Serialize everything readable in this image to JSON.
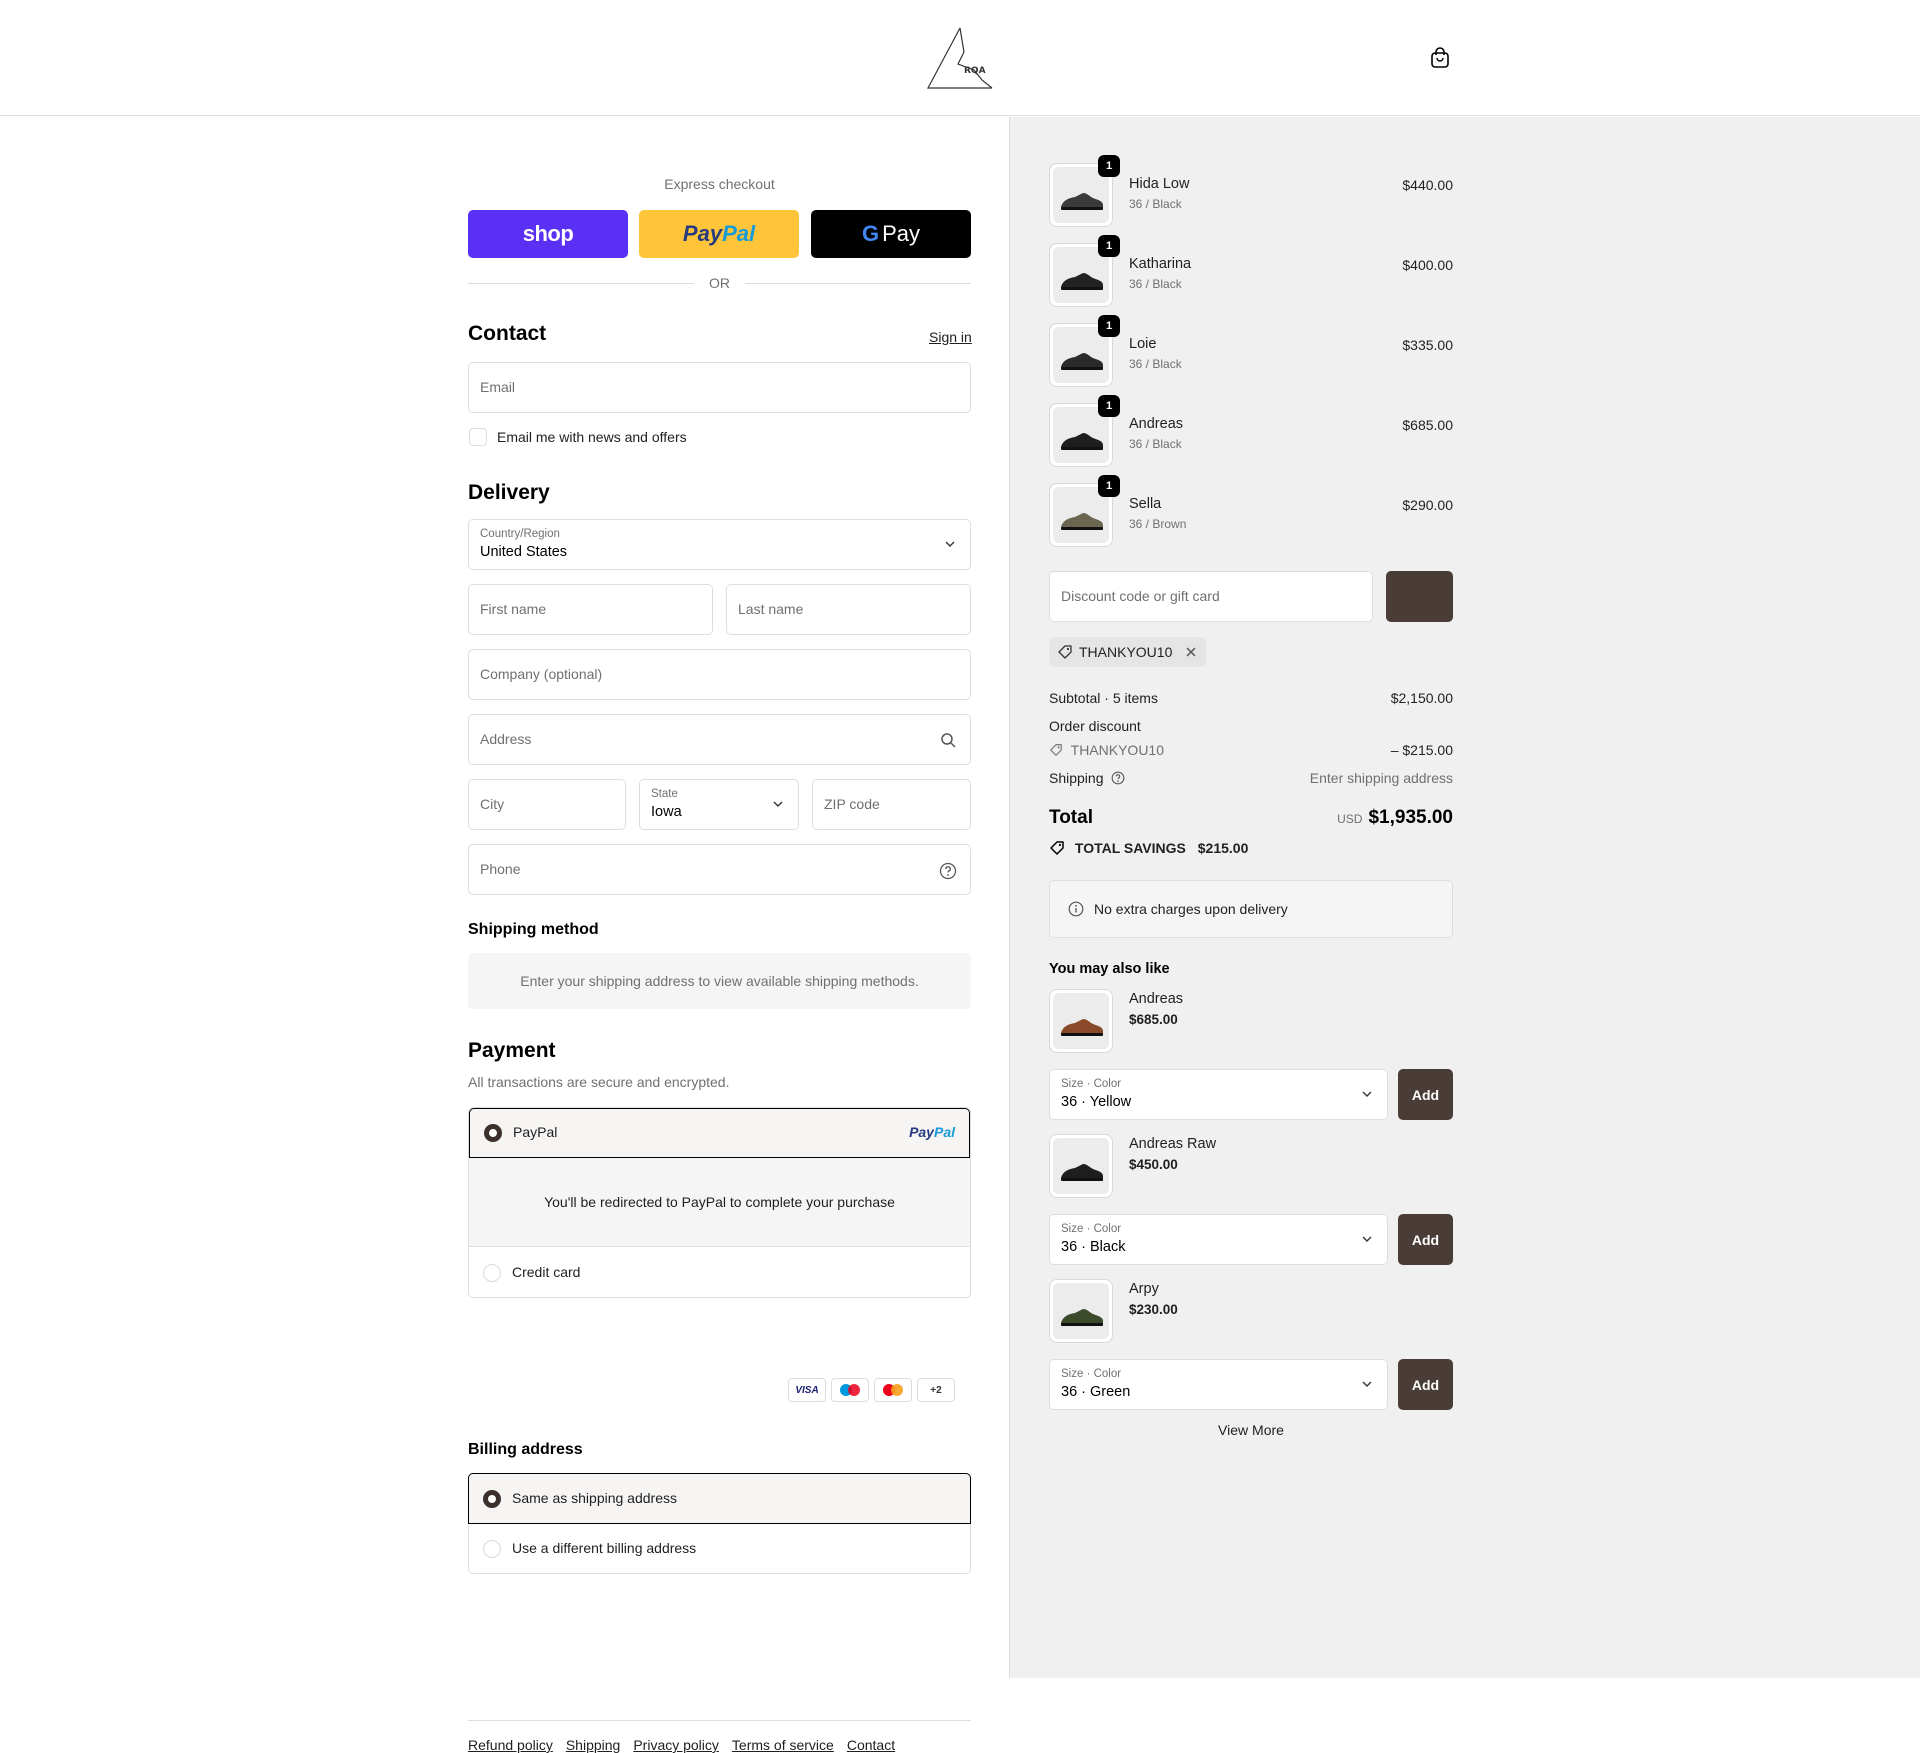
{
  "header": {
    "logo_text": "RQA"
  },
  "express": {
    "title": "Express checkout",
    "shop_label": "shop",
    "paypal_label_1": "Pay",
    "paypal_label_2": "Pal",
    "gpay_g": "G",
    "gpay_label": "Pay",
    "or_label": "OR"
  },
  "contact": {
    "heading": "Contact",
    "signin_label": "Sign in",
    "email_placeholder": "Email",
    "news_label": "Email me with news and offers"
  },
  "delivery": {
    "heading": "Delivery",
    "country_label": "Country/Region",
    "country_value": "United States",
    "first_name_placeholder": "First name",
    "last_name_placeholder": "Last name",
    "company_placeholder": "Company (optional)",
    "address_placeholder": "Address",
    "city_placeholder": "City",
    "state_label": "State",
    "state_value": "Iowa",
    "zip_placeholder": "ZIP code",
    "phone_placeholder": "Phone"
  },
  "shipping_method": {
    "heading": "Shipping method",
    "message": "Enter your shipping address to view available shipping methods."
  },
  "payment": {
    "heading": "Payment",
    "subtitle": "All transactions are secure and encrypted.",
    "paypal_option": "PayPal",
    "paypal_logo_1": "Pay",
    "paypal_logo_2": "Pal",
    "paypal_info": "You'll be redirected to PayPal to complete your purchase",
    "credit_option": "Credit card",
    "card_visa": "VISA",
    "card_more": "+2"
  },
  "billing": {
    "heading": "Billing address",
    "same_option": "Same as shipping address",
    "different_option": "Use a different billing address"
  },
  "footer": {
    "links": [
      "Refund policy",
      "Shipping",
      "Privacy policy",
      "Terms of service",
      "Contact"
    ]
  },
  "cart": {
    "items": [
      {
        "name": "Hida Low",
        "variant": "36 / Black",
        "price": "$440.00",
        "qty": "1",
        "color": "#3a3a3a"
      },
      {
        "name": "Katharina",
        "variant": "36 / Black",
        "price": "$400.00",
        "qty": "1",
        "color": "#222222"
      },
      {
        "name": "Loie",
        "variant": "36 / Black",
        "price": "$335.00",
        "qty": "1",
        "color": "#2a2a2a"
      },
      {
        "name": "Andreas",
        "variant": "36 / Black",
        "price": "$685.00",
        "qty": "1",
        "color": "#1e1e1e"
      },
      {
        "name": "Sella",
        "variant": "36 / Brown",
        "price": "$290.00",
        "qty": "1",
        "color": "#6b6650"
      }
    ],
    "discount_placeholder": "Discount code or gift card",
    "applied_code": "THANKYOU10"
  },
  "summary": {
    "subtotal_label": "Subtotal · 5 items",
    "subtotal_value": "$2,150.00",
    "order_discount_label": "Order discount",
    "discount_code": "THANKYOU10",
    "discount_value": "– $215.00",
    "shipping_label": "Shipping",
    "shipping_value": "Enter shipping address",
    "total_label": "Total",
    "currency": "USD",
    "total_value": "$1,935.00",
    "savings_label": "TOTAL SAVINGS",
    "savings_value": "$215.00",
    "info_message": "No extra charges upon delivery"
  },
  "recommendations": {
    "heading": "You may also like",
    "select_label": "Size · Color",
    "add_label": "Add",
    "view_more": "View More",
    "items": [
      {
        "name": "Andreas",
        "price": "$685.00",
        "selection": "36 · Yellow",
        "color": "#8a4a2a"
      },
      {
        "name": "Andreas Raw",
        "price": "$450.00",
        "selection": "36 · Black",
        "color": "#1e1e1e"
      },
      {
        "name": "Arpy",
        "price": "$230.00",
        "selection": "36 · Green",
        "color": "#3a4a2a"
      }
    ]
  },
  "colors": {
    "shop_purple": "#5a31f4",
    "paypal_yellow": "#ffc439",
    "accent_brown": "#4a3d37",
    "sidebar_bg": "#f0f0f0"
  }
}
